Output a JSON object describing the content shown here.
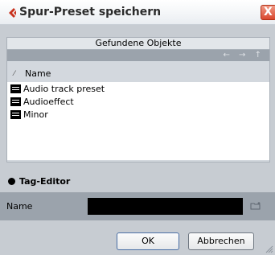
{
  "window": {
    "title": "Spur-Preset speichern",
    "close_symbol": "X"
  },
  "objects_panel": {
    "header": "Gefundene Objekte",
    "nav_arrows": "← → ↑",
    "column_name": "Name",
    "sort_icon": "⁄",
    "items": [
      {
        "label": "Audio track preset",
        "icon": "list-icon"
      },
      {
        "label": "Audioeffect",
        "icon": "list-icon"
      },
      {
        "label": "Minor",
        "icon": "list-icon"
      }
    ]
  },
  "tag_editor": {
    "label": "Tag-Editor",
    "name_label": "Name",
    "name_value": ""
  },
  "buttons": {
    "ok": "OK",
    "cancel": "Abbrechen"
  },
  "colors": {
    "title_accent": "#d9472e",
    "panel_bg": "#c7ccd2",
    "bar_bg": "#9ba3ac"
  }
}
